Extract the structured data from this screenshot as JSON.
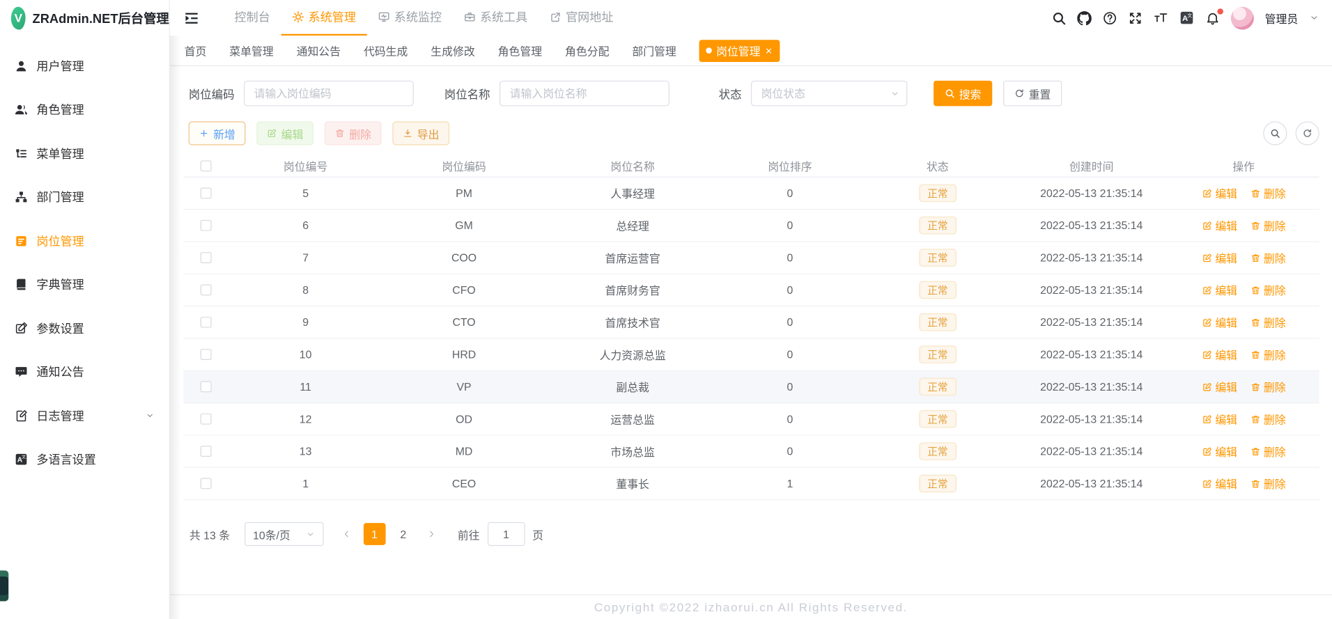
{
  "app": {
    "title": "ZRAdmin.NET后台管理",
    "logo_letter": "V"
  },
  "theme": {
    "primary": "#ff9700",
    "warning_badge": "#e6a23c",
    "notification_dot": "#f5564c",
    "logo_green": "#35b981"
  },
  "sidebar": {
    "items": [
      {
        "key": "user",
        "label": "用户管理",
        "icon": "user-icon"
      },
      {
        "key": "role",
        "label": "角色管理",
        "icon": "users-icon"
      },
      {
        "key": "menu",
        "label": "菜单管理",
        "icon": "menu-tree-icon"
      },
      {
        "key": "dept",
        "label": "部门管理",
        "icon": "org-tree-icon"
      },
      {
        "key": "post",
        "label": "岗位管理",
        "icon": "post-icon",
        "active": true
      },
      {
        "key": "dict",
        "label": "字典管理",
        "icon": "dictionary-icon"
      },
      {
        "key": "param",
        "label": "参数设置",
        "icon": "param-icon"
      },
      {
        "key": "notice",
        "label": "通知公告",
        "icon": "message-icon"
      },
      {
        "key": "log",
        "label": "日志管理",
        "icon": "log-icon",
        "has_children": true
      },
      {
        "key": "i18n",
        "label": "多语言设置",
        "icon": "language-square-icon"
      }
    ]
  },
  "topnav": {
    "items": [
      {
        "key": "console",
        "label": "控制台"
      },
      {
        "key": "system",
        "label": "系统管理",
        "icon": "gear-icon",
        "active": true
      },
      {
        "key": "monitor",
        "label": "系统监控",
        "icon": "monitor-check-icon"
      },
      {
        "key": "tool",
        "label": "系统工具",
        "icon": "toolbox-icon"
      },
      {
        "key": "site",
        "label": "官网地址",
        "icon": "external-link-icon"
      }
    ]
  },
  "header_right": {
    "user_label": "管理员",
    "icons": [
      "search-icon",
      "github-icon",
      "help-icon",
      "fullscreen-icon",
      "font-size-icon",
      "language-square-icon",
      "bell-icon"
    ],
    "has_notification_dot": true
  },
  "tabs": {
    "items": [
      {
        "key": "home",
        "label": "首页"
      },
      {
        "key": "menu",
        "label": "菜单管理"
      },
      {
        "key": "notice",
        "label": "通知公告"
      },
      {
        "key": "codegen",
        "label": "代码生成"
      },
      {
        "key": "genedit",
        "label": "生成修改"
      },
      {
        "key": "role",
        "label": "角色管理"
      },
      {
        "key": "roleassign",
        "label": "角色分配"
      },
      {
        "key": "dept",
        "label": "部门管理"
      },
      {
        "key": "post",
        "label": "岗位管理",
        "active": true,
        "closable": true
      }
    ]
  },
  "filters": {
    "code": {
      "label": "岗位编码",
      "placeholder": "请输入岗位编码",
      "value": ""
    },
    "name": {
      "label": "岗位名称",
      "placeholder": "请输入岗位名称",
      "value": ""
    },
    "status": {
      "label": "状态",
      "placeholder": "岗位状态",
      "value": ""
    },
    "search_label": "搜索",
    "reset_label": "重置"
  },
  "toolbar": {
    "add_label": "新增",
    "edit_label": "编辑",
    "delete_label": "删除",
    "export_label": "导出"
  },
  "table": {
    "columns": [
      "岗位编号",
      "岗位编码",
      "岗位名称",
      "岗位排序",
      "状态",
      "创建时间",
      "操作"
    ],
    "edit_label": "编辑",
    "delete_label": "删除",
    "rows": [
      {
        "id": "5",
        "code": "PM",
        "name": "人事经理",
        "sort": "0",
        "status": "正常",
        "created": "2022-05-13 21:35:14"
      },
      {
        "id": "6",
        "code": "GM",
        "name": "总经理",
        "sort": "0",
        "status": "正常",
        "created": "2022-05-13 21:35:14"
      },
      {
        "id": "7",
        "code": "COO",
        "name": "首席运营官",
        "sort": "0",
        "status": "正常",
        "created": "2022-05-13 21:35:14"
      },
      {
        "id": "8",
        "code": "CFO",
        "name": "首席财务官",
        "sort": "0",
        "status": "正常",
        "created": "2022-05-13 21:35:14"
      },
      {
        "id": "9",
        "code": "CTO",
        "name": "首席技术官",
        "sort": "0",
        "status": "正常",
        "created": "2022-05-13 21:35:14"
      },
      {
        "id": "10",
        "code": "HRD",
        "name": "人力资源总监",
        "sort": "0",
        "status": "正常",
        "created": "2022-05-13 21:35:14"
      },
      {
        "id": "11",
        "code": "VP",
        "name": "副总裁",
        "sort": "0",
        "status": "正常",
        "created": "2022-05-13 21:35:14",
        "highlighted": true
      },
      {
        "id": "12",
        "code": "OD",
        "name": "运营总监",
        "sort": "0",
        "status": "正常",
        "created": "2022-05-13 21:35:14"
      },
      {
        "id": "13",
        "code": "MD",
        "name": "市场总监",
        "sort": "0",
        "status": "正常",
        "created": "2022-05-13 21:35:14"
      },
      {
        "id": "1",
        "code": "CEO",
        "name": "董事长",
        "sort": "1",
        "status": "正常",
        "created": "2022-05-13 21:35:14"
      }
    ]
  },
  "pagination": {
    "total_text": "共 13 条",
    "page_size": "10条/页",
    "pages": [
      "1",
      "2"
    ],
    "current": "1",
    "goto_label": "前往",
    "goto_value": "1",
    "page_unit": "页"
  },
  "footer": {
    "copyright": "Copyright ©2022 izhaorui.cn All Rights Reserved."
  }
}
